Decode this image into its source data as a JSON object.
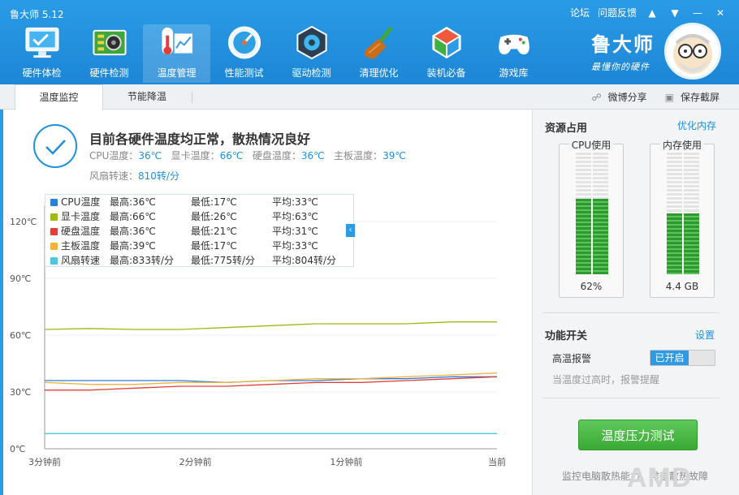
{
  "app": {
    "title": "鲁大师 5.12"
  },
  "top_links": {
    "forum": "论坛",
    "feedback": "问题反馈"
  },
  "nav": [
    {
      "label": "硬件体检",
      "icon": "monitor-check-icon"
    },
    {
      "label": "硬件检测",
      "icon": "circuit-board-icon"
    },
    {
      "label": "温度管理",
      "icon": "thermometer-icon",
      "active": true
    },
    {
      "label": "性能测试",
      "icon": "speedometer-icon"
    },
    {
      "label": "驱动检测",
      "icon": "driver-gear-icon"
    },
    {
      "label": "清理优化",
      "icon": "broom-icon"
    },
    {
      "label": "装机必备",
      "icon": "install-cube-icon"
    },
    {
      "label": "游戏库",
      "icon": "gamepad-icon"
    }
  ],
  "brand": {
    "name": "鲁大师",
    "slogan": "最懂你的硬件"
  },
  "subtabs": {
    "temp_monitor": "温度监控",
    "energy_cool": "节能降温"
  },
  "actions": {
    "share": "微博分享",
    "save": "保存截屏"
  },
  "status": {
    "title": "目前各硬件温度均正常，散热情况良好",
    "cpu_label": "CPU温度：",
    "cpu_value": "36℃",
    "gpu_label": "显卡温度：",
    "gpu_value": "66℃",
    "disk_label": "硬盘温度：",
    "disk_value": "36℃",
    "board_label": "主板温度：",
    "board_value": "39℃",
    "fan_label": "风扇转速：",
    "fan_value": "810转/分"
  },
  "legend": [
    {
      "name": "CPU温度",
      "max": "最高:36℃",
      "min": "最低:17℃",
      "avg": "平均:33℃",
      "color": "#2b7fd9"
    },
    {
      "name": "显卡温度",
      "max": "最高:66℃",
      "min": "最低:26℃",
      "avg": "平均:63℃",
      "color": "#a3b814"
    },
    {
      "name": "硬盘温度",
      "max": "最高:36℃",
      "min": "最低:21℃",
      "avg": "平均:31℃",
      "color": "#e0403a"
    },
    {
      "name": "主板温度",
      "max": "最高:39℃",
      "min": "最低:17℃",
      "avg": "平均:33℃",
      "color": "#f2b33d"
    },
    {
      "name": "风扇转速",
      "max": "最高:833转/分",
      "min": "最低:775转/分",
      "avg": "平均:804转/分",
      "color": "#4ec6e0"
    }
  ],
  "chart_data": {
    "type": "line",
    "y_tick_labels": [
      "0℃",
      "30℃",
      "60℃",
      "90℃",
      "120℃"
    ],
    "x_tick_labels": [
      "3分钟前",
      "2分钟前",
      "1分钟前",
      "当前"
    ],
    "ylim": [
      0,
      120
    ],
    "grid": true,
    "x": [
      0,
      10,
      20,
      30,
      40,
      50,
      60,
      70,
      80,
      90,
      100
    ],
    "series": [
      {
        "name": "CPU温度",
        "values": [
          36,
          36,
          36,
          36,
          35,
          36,
          36,
          37,
          37,
          38,
          38
        ]
      },
      {
        "name": "显卡温度",
        "values": [
          63,
          63.5,
          63,
          63,
          64,
          65,
          66,
          66,
          66,
          67,
          67
        ]
      },
      {
        "name": "硬盘温度",
        "values": [
          31,
          31,
          32,
          33,
          33,
          34,
          35,
          35,
          36,
          37,
          38
        ]
      },
      {
        "name": "主板温度",
        "values": [
          35,
          34,
          34,
          35,
          35,
          36,
          37,
          37,
          38,
          39,
          40
        ]
      },
      {
        "name": "风扇转速",
        "values": [
          8,
          8,
          8,
          8,
          8,
          8,
          8,
          8,
          8,
          8,
          8
        ]
      }
    ]
  },
  "resources": {
    "title": "资源占用",
    "optimize": "优化内存",
    "cpu_label": "CPU使用",
    "cpu_value": "62%",
    "cpu_fraction": 0.62,
    "mem_label": "内存使用",
    "mem_value": "4.4 GB",
    "mem_fraction": 0.5
  },
  "functions": {
    "title": "功能开关",
    "settings": "设置",
    "alarm_label": "高温报警",
    "alarm_state": "已开启",
    "alarm_desc": "当温度过高时，报警提醒"
  },
  "test_button": "温度压力测试",
  "foot_note": "监控电脑散热能力，排查散热故障",
  "watermark": "AMD"
}
